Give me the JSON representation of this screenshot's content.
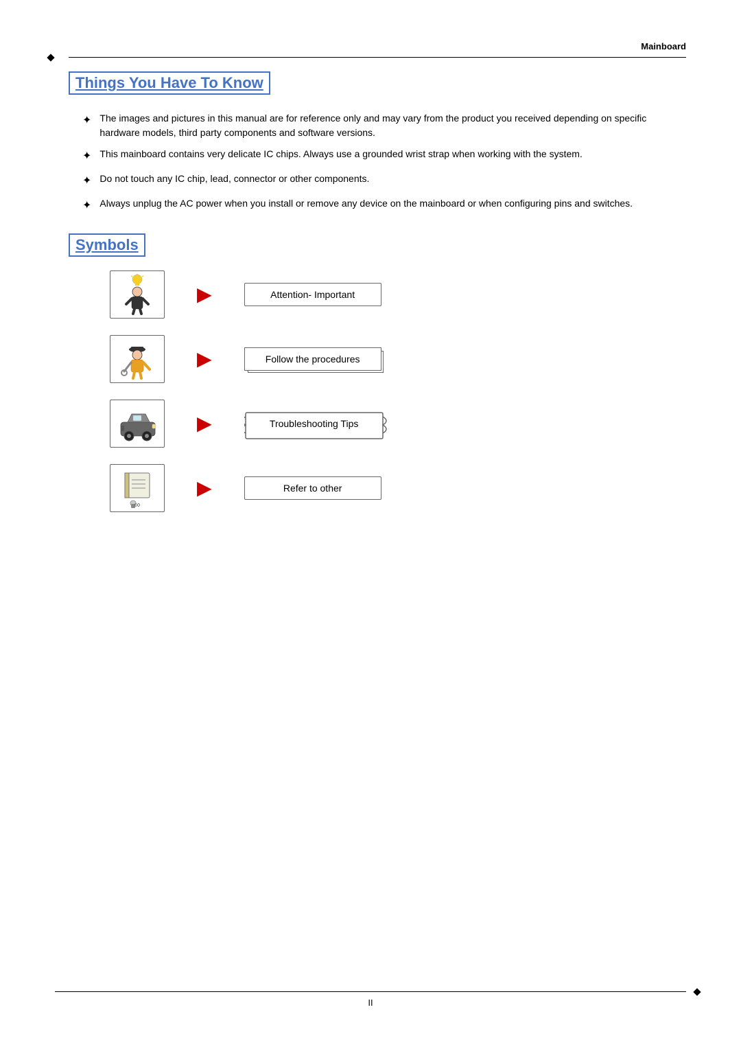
{
  "header": {
    "title": "Mainboard"
  },
  "main_section": {
    "title": "Things You Have To Know",
    "bullets": [
      "The images and pictures in this manual are for reference only and may vary from the product you received depending on specific hardware models, third party components and software versions.",
      "This mainboard contains very delicate IC chips. Always use a grounded wrist strap when working with the system.",
      "Do not touch any IC chip, lead, connector or other components.",
      "Always unplug the AC power when you install or remove any device on the mainboard or when configuring pins and switches."
    ]
  },
  "symbols_section": {
    "title": "Symbols",
    "items": [
      {
        "label": "Attention- Important",
        "shape": "rect"
      },
      {
        "label": "Follow the procedures",
        "shape": "double-rect"
      },
      {
        "label": "Troubleshooting Tips",
        "shape": "wavy"
      },
      {
        "label": "Refer to other",
        "shape": "rect"
      }
    ]
  },
  "footer": {
    "page_number": "II"
  }
}
